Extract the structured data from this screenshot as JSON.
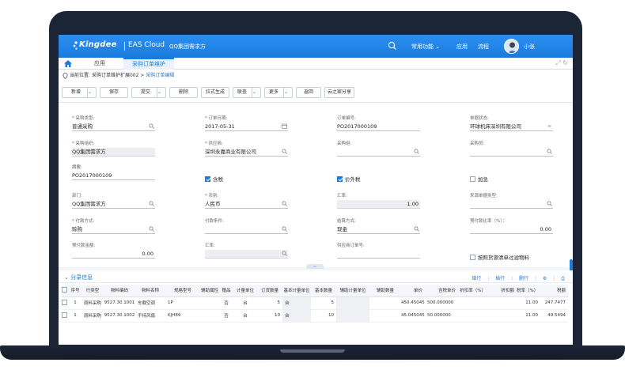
{
  "header": {
    "brand": "Kingdee",
    "product": "EAS Cloud",
    "org": "QQ集团需求方",
    "links": [
      "常用功能",
      "应用",
      "流程"
    ],
    "user": "小张"
  },
  "tabs": [
    {
      "label": "应用"
    },
    {
      "label": "采购订单维护"
    }
  ],
  "breadcrumb": {
    "prefix": "当前位置:",
    "path": "采购订单维护扩展002",
    "sep": ">",
    "current": "采购订单编辑"
  },
  "toolbar": {
    "new": "新增",
    "save": "保存",
    "submit": "提交",
    "delete": "删除",
    "pull": "拉式生成",
    "linked": "联查",
    "more": "更多",
    "back": "返回",
    "share": "云之家分享"
  },
  "form": {
    "purchase_type": {
      "label": "采购类型:",
      "value": "普通采购"
    },
    "order_date": {
      "label": "订单日期:",
      "value": "2017-05-31"
    },
    "order_no": {
      "label": "订单编号:",
      "value": "PO2017000109"
    },
    "bill_status": {
      "label": "单据状态:",
      "value": "环球机床深圳有限公司"
    },
    "purchase_org": {
      "label": "采购组织:",
      "value": "QQ集团需求方"
    },
    "supplier": {
      "label": "供应商:",
      "value": "深圳永嘉商业有限公司"
    },
    "purchase_group": {
      "label": "采购组:",
      "value": ""
    },
    "purchaser": {
      "label": "采购员:",
      "value": ""
    },
    "summary": {
      "label": "摘要:",
      "value": "PO2017000109"
    },
    "tax_included": {
      "label": "含税",
      "checked": true
    },
    "price_ex_tax": {
      "label": "价外税",
      "checked": true
    },
    "urgent": {
      "label": "加急",
      "checked": false
    },
    "department": {
      "label": "部门:",
      "value": "QQ集团需求方"
    },
    "currency": {
      "label": "币别:",
      "value": "人民币"
    },
    "exchange_rate": {
      "label": "汇率:",
      "value": "1.00"
    },
    "source_type": {
      "label": "来源单据类型:",
      "value": ""
    },
    "payment_method": {
      "label": "付款方式:",
      "value": "赊购"
    },
    "payment_terms": {
      "label": "付款条件:",
      "value": ""
    },
    "settlement": {
      "label": "结算方式:",
      "value": "现金"
    },
    "prepay_ratio": {
      "label": "预付款比率（%）：",
      "value": "0.00"
    },
    "prepay_amount": {
      "label": "预付款金额:",
      "value": "0.00"
    },
    "rate2": {
      "label": "汇率:",
      "value": ""
    },
    "supplier_order_no": {
      "label": "供应商订单号:",
      "value": ""
    },
    "filter_by_list": {
      "label": "按照货源清单过滤物料",
      "checked": false
    }
  },
  "entry": {
    "title": "分录信息",
    "actions": [
      "增行",
      "插行",
      "删行"
    ],
    "columns": [
      "序号",
      "行类型",
      "物料编码",
      "物料名称",
      "规格型号",
      "辅助属性",
      "赠品",
      "计量单位",
      "订货数量",
      "基本计量单位",
      "基本数量",
      "辅助计量单位",
      "辅助数量",
      "单价",
      "含税单价",
      "折扣率（%）",
      "折扣额",
      "税率（%）",
      "税额"
    ],
    "rows": [
      [
        "1",
        "原料采购",
        "9527.30.1001",
        "车载空调",
        "1P",
        "",
        "否",
        "台",
        "5",
        "台",
        "5",
        "",
        "",
        "450.450450",
        "500.000000",
        "",
        "",
        "11.00",
        "247.7477"
      ],
      [
        "1",
        "原料采购",
        "9527.30.1002",
        "手持风扇",
        "KJH89",
        "",
        "否",
        "台",
        "10",
        "台",
        "10",
        "",
        "",
        "45.045045",
        "50.000000",
        "",
        "",
        "11.00",
        "49.5494"
      ]
    ]
  },
  "colors": {
    "brand": "#1a7bdd",
    "frame": "#1c2536"
  }
}
